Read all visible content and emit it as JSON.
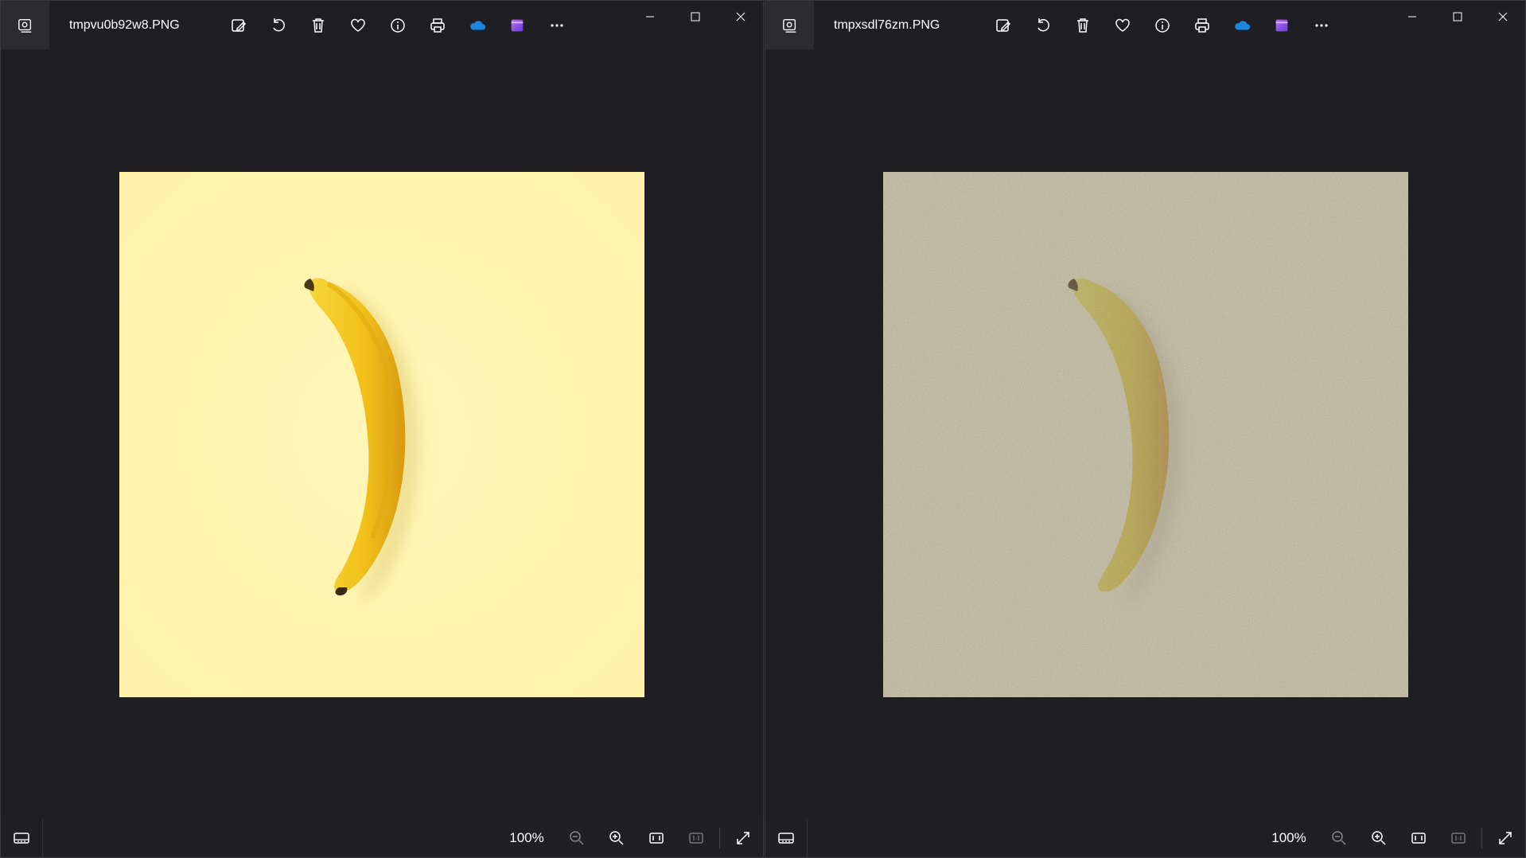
{
  "windows": [
    {
      "filename": "tmpvu0b92w8.PNG",
      "zoom": "100%",
      "image": {
        "background": "#fff3b0",
        "noisy": false
      }
    },
    {
      "filename": "tmpxsdl76zm.PNG",
      "zoom": "100%",
      "image": {
        "background": "#d9d2b8",
        "noisy": true
      }
    }
  ],
  "toolbar_icons": [
    "edit-image-icon",
    "rotate-icon",
    "delete-icon",
    "favorite-icon",
    "info-icon",
    "print-icon",
    "onedrive-icon",
    "clipchamp-icon",
    "more-icon"
  ],
  "statusbar_icons": [
    "filmstrip-icon",
    "zoom-out-icon",
    "zoom-in-icon",
    "fit-to-window-icon",
    "actual-size-icon",
    "fullscreen-icon"
  ],
  "colors": {
    "window_bg": "#1f1f23",
    "onedrive": "#1a86e0",
    "clipchamp": "#8a4fe0"
  }
}
